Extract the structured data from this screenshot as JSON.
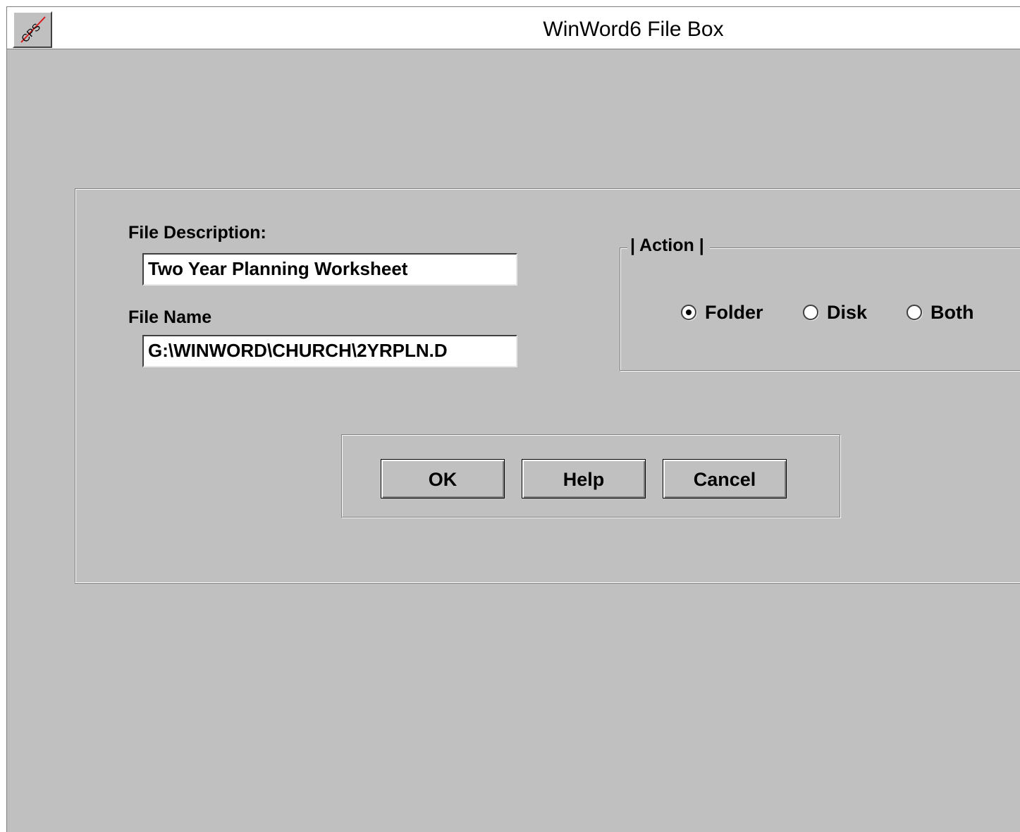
{
  "window": {
    "title": "WinWord6 File Box",
    "system_menu_icon": "cps-pencil-icon",
    "system_menu_text": "CPS"
  },
  "form": {
    "file_description_label": "File Description:",
    "file_description_value": "Two Year Planning Worksheet",
    "file_name_label": "File Name",
    "file_name_value": "G:\\WINWORD\\CHURCH\\2YRPLN.D"
  },
  "action_group": {
    "legend": "| Action |",
    "options": [
      {
        "label": "Folder",
        "checked": true
      },
      {
        "label": "Disk",
        "checked": false
      },
      {
        "label": "Both",
        "checked": false
      }
    ]
  },
  "buttons": {
    "ok": "OK",
    "help": "Help",
    "cancel": "Cancel"
  },
  "colors": {
    "face": "#c0c0c0",
    "shadow": "#808080",
    "highlight": "#ffffff",
    "icon_slash": "#d81818"
  }
}
